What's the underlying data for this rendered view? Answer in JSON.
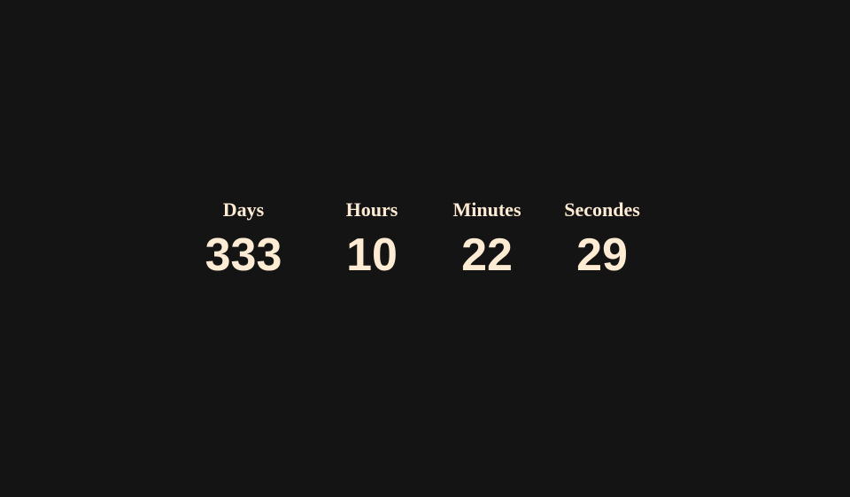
{
  "countdown": {
    "days": {
      "label": "Days",
      "value": "333"
    },
    "hours": {
      "label": "Hours",
      "value": "10"
    },
    "minutes": {
      "label": "Minutes",
      "value": "22"
    },
    "seconds": {
      "label": "Secondes",
      "value": "29"
    }
  },
  "colors": {
    "background": "#141414",
    "text": "#fdebd3"
  }
}
